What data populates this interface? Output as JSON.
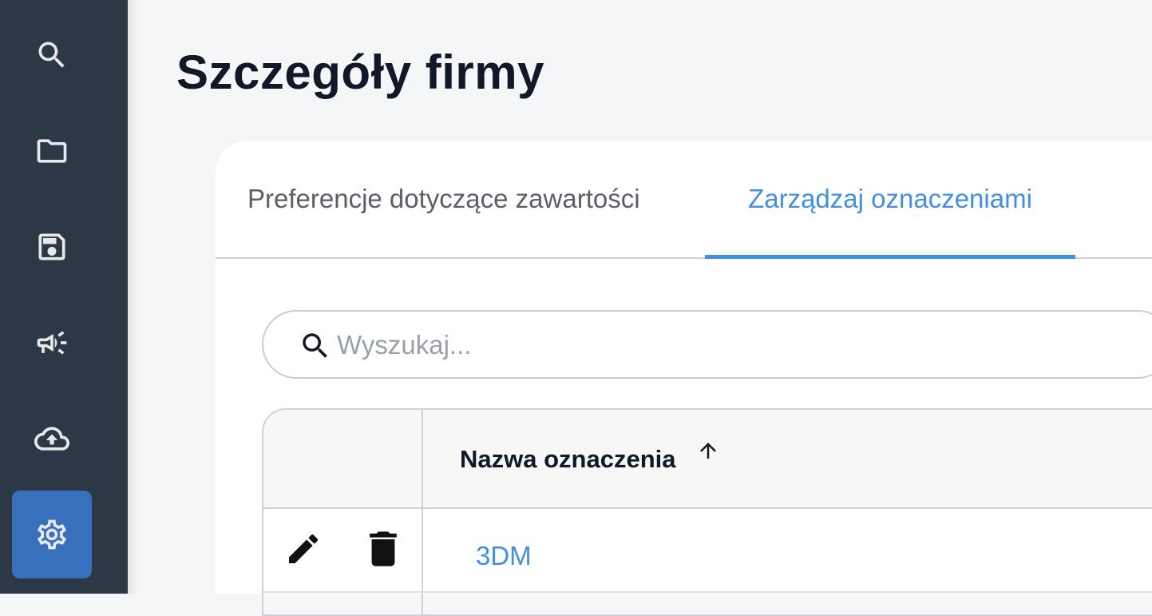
{
  "sidebar": {
    "items": [
      {
        "icon": "search-icon",
        "active": false
      },
      {
        "icon": "folder-icon",
        "active": false
      },
      {
        "icon": "save-icon",
        "active": false
      },
      {
        "icon": "megaphone-icon",
        "active": false
      },
      {
        "icon": "cloud-upload-icon",
        "active": false
      },
      {
        "icon": "gear-icon",
        "active": true
      }
    ]
  },
  "page": {
    "title": "Szczegóły firmy"
  },
  "tabs": [
    {
      "label": "Preferencje dotyczące zawartości",
      "active": false
    },
    {
      "label": "Zarządzaj oznaczeniami",
      "active": true
    }
  ],
  "search": {
    "placeholder": "Wyszukaj..."
  },
  "table": {
    "columns": [
      {
        "label": "Nazwa oznaczenia",
        "sort": "ascending"
      }
    ],
    "rows": [
      {
        "name": "3DM"
      }
    ]
  },
  "colors": {
    "sidebar_bg": "#2d3846",
    "active_nav": "#3870bd",
    "accent": "#4390e0",
    "page_bg": "#f5f6f8"
  }
}
